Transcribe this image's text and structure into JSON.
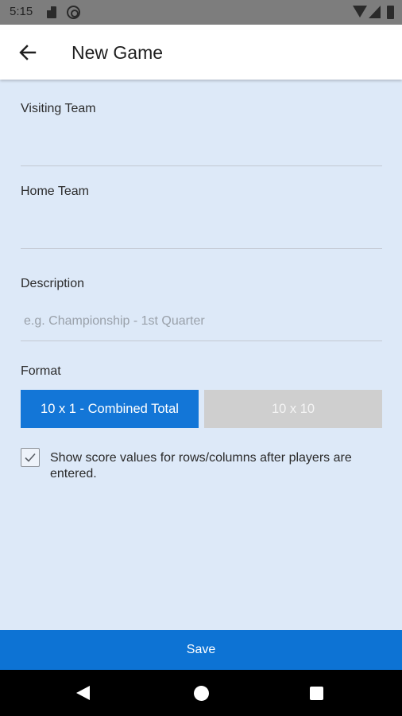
{
  "status_bar": {
    "time": "5:15",
    "icons": [
      "sd-card-icon",
      "data-saver-icon",
      "wifi-icon",
      "signal-icon",
      "battery-icon"
    ]
  },
  "app_bar": {
    "back_icon": "arrow-left-icon",
    "title": "New Game"
  },
  "form": {
    "visiting_team": {
      "label": "Visiting Team",
      "value": "",
      "placeholder": ""
    },
    "home_team": {
      "label": "Home Team",
      "value": "",
      "placeholder": ""
    },
    "description": {
      "label": "Description",
      "value": "",
      "placeholder": "e.g. Championship - 1st Quarter"
    },
    "format": {
      "label": "Format",
      "options": [
        "10 x 1 - Combined Total",
        "10 x 10"
      ],
      "selected": "10 x 1 - Combined Total"
    },
    "show_scores": {
      "checked": true,
      "label": "Show score values for rows/columns after players are entered."
    }
  },
  "save_label": "Save",
  "colors": {
    "background": "#dde9f8",
    "accent": "#1376d7",
    "inactive_button": "#cfcfcf",
    "save_bar": "#0d73d4"
  },
  "nav_bar": {
    "icons": [
      "nav-back-icon",
      "nav-home-icon",
      "nav-recents-icon"
    ]
  }
}
